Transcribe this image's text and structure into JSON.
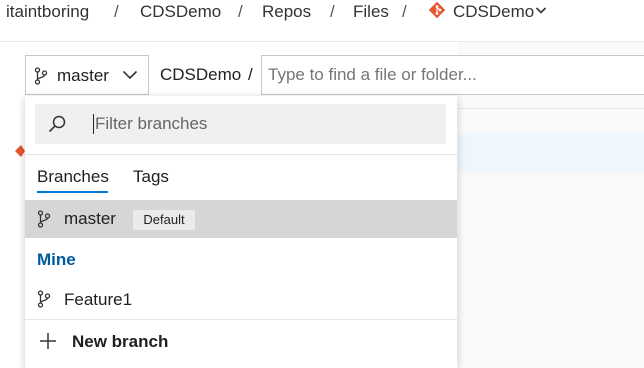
{
  "breadcrumb": {
    "items": [
      "itaintboring",
      "CDSDemo",
      "Repos",
      "Files",
      "CDSDemo"
    ],
    "separator": "/"
  },
  "branch_selector": {
    "current": "master"
  },
  "path": {
    "repo": "CDSDemo",
    "separator": "/"
  },
  "file_search": {
    "placeholder": "Type to find a file or folder..."
  },
  "dropdown": {
    "filter_placeholder": "Filter branches",
    "tabs": [
      {
        "label": "Branches",
        "active": true
      },
      {
        "label": "Tags",
        "active": false
      }
    ],
    "default_branch": {
      "name": "master",
      "badge": "Default"
    },
    "mine_section": {
      "header": "Mine",
      "branches": [
        "Feature1"
      ]
    },
    "new_branch_label": "New branch"
  },
  "colors": {
    "accent": "#0078d4",
    "git_brand": "#e8542b",
    "section_header": "#005a9e",
    "selected_row": "#d6d6d6"
  }
}
